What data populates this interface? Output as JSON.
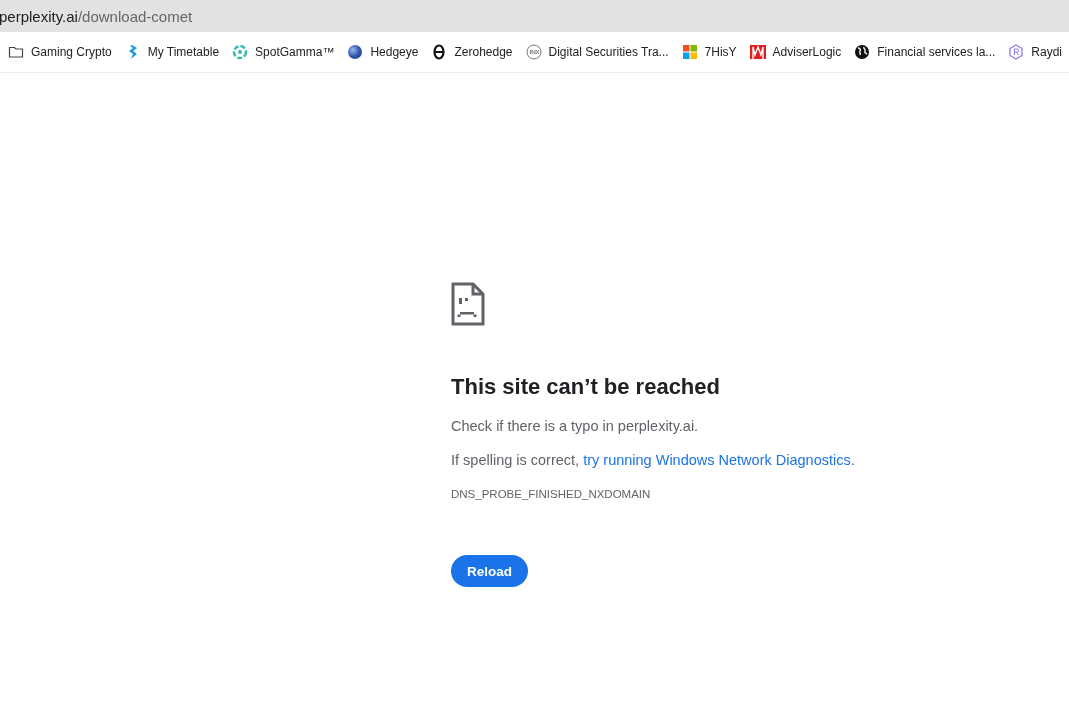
{
  "address_bar": {
    "domain": "perplexity.ai",
    "path": "/download-comet"
  },
  "bookmarks": [
    {
      "label": "Gaming Crypto",
      "kind": "folder"
    },
    {
      "label": "My Timetable",
      "kind": "site"
    },
    {
      "label": "SpotGamma™",
      "kind": "site"
    },
    {
      "label": "Hedgeye",
      "kind": "site"
    },
    {
      "label": "Zerohedge",
      "kind": "site"
    },
    {
      "label": "Digital Securities Tra...",
      "kind": "site"
    },
    {
      "label": "7HisY",
      "kind": "site"
    },
    {
      "label": "AdviserLogic",
      "kind": "site"
    },
    {
      "label": "Financial services la...",
      "kind": "site"
    },
    {
      "label": "Raydi",
      "kind": "site"
    }
  ],
  "error": {
    "title": "This site can’t be reached",
    "line_1": "Check if there is a typo in perplexity.ai.",
    "line_2_prefix": "If spelling is correct, ",
    "line_2_link": "try running Windows Network Diagnostics",
    "line_2_suffix": ".",
    "code": "DNS_PROBE_FINISHED_NXDOMAIN",
    "button": "Reload"
  }
}
